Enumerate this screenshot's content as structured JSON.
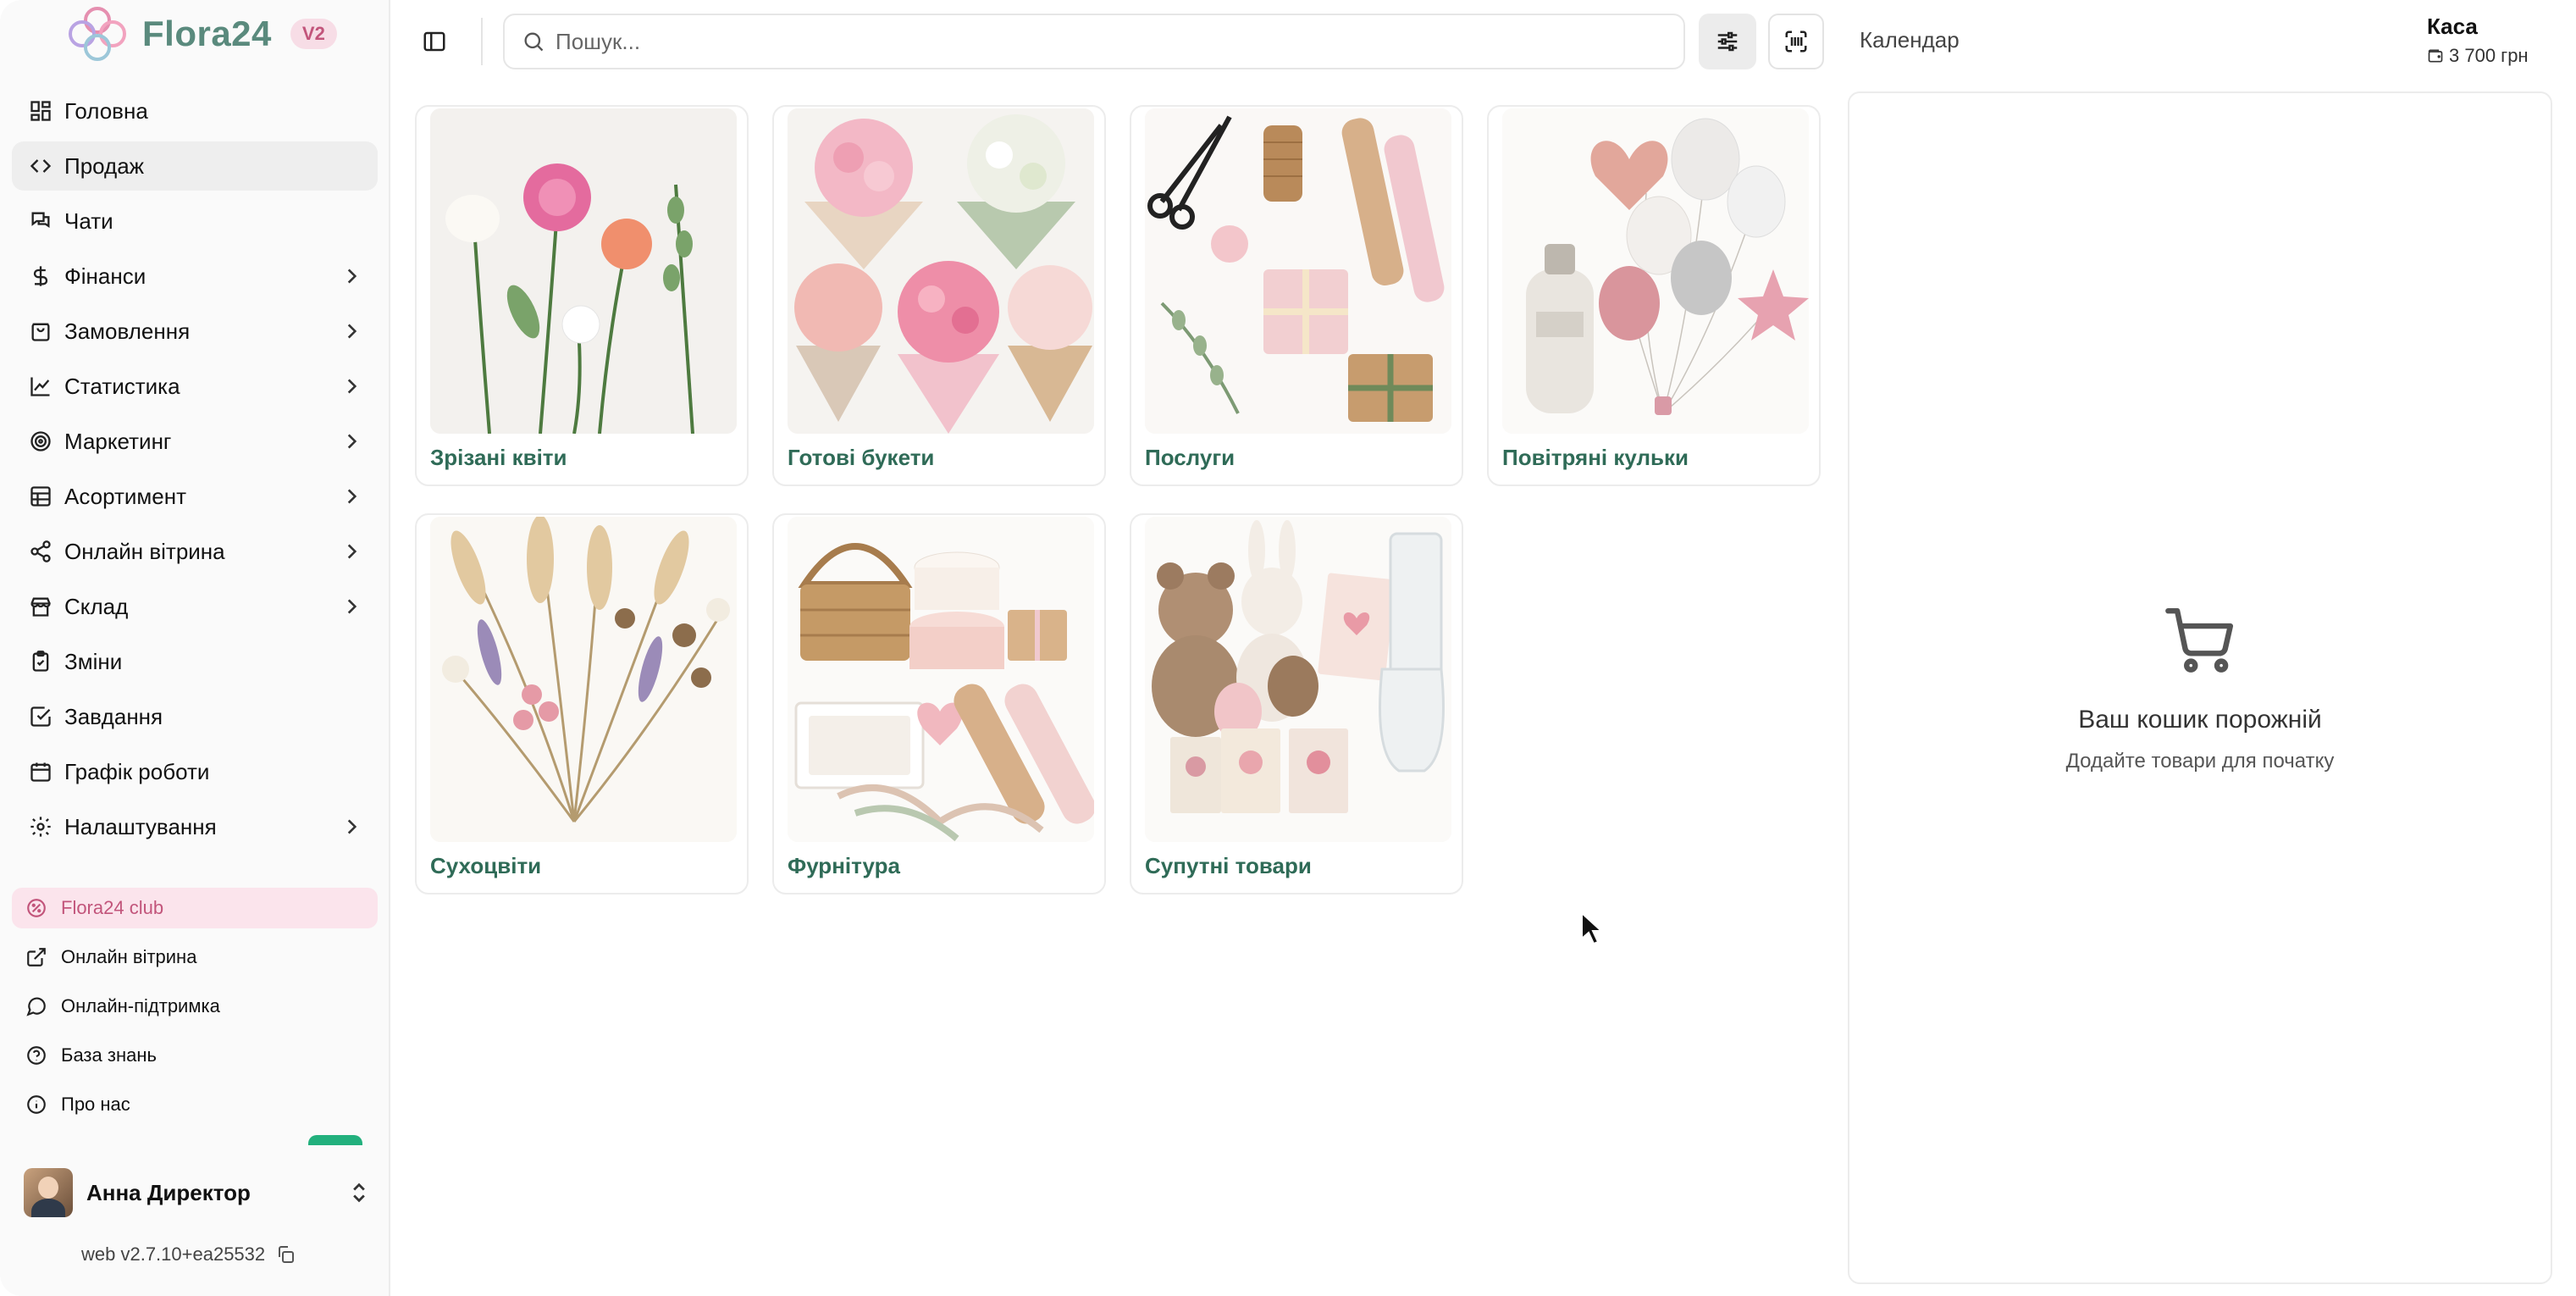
{
  "brand": {
    "name": "Flora24",
    "badge": "V2"
  },
  "nav": [
    {
      "label": "Головна",
      "icon": "grid-icon",
      "chevron": false,
      "active": false
    },
    {
      "label": "Продаж",
      "icon": "code-icon",
      "chevron": false,
      "active": true
    },
    {
      "label": "Чати",
      "icon": "chat-icon",
      "chevron": false,
      "active": false
    },
    {
      "label": "Фінанси",
      "icon": "dollar-icon",
      "chevron": true,
      "active": false
    },
    {
      "label": "Замовлення",
      "icon": "bag-icon",
      "chevron": true,
      "active": false
    },
    {
      "label": "Статистика",
      "icon": "line-chart-icon",
      "chevron": true,
      "active": false
    },
    {
      "label": "Маркетинг",
      "icon": "target-icon",
      "chevron": true,
      "active": false
    },
    {
      "label": "Асортимент",
      "icon": "table-icon",
      "chevron": true,
      "active": false
    },
    {
      "label": "Онлайн вітрина",
      "icon": "share-icon",
      "chevron": true,
      "active": false
    },
    {
      "label": "Склад",
      "icon": "store-icon",
      "chevron": true,
      "active": false
    },
    {
      "label": "Зміни",
      "icon": "clipboard-icon",
      "chevron": false,
      "active": false
    },
    {
      "label": "Завдання",
      "icon": "check-square-icon",
      "chevron": false,
      "active": false
    },
    {
      "label": "Графік роботи",
      "icon": "calendar-icon",
      "chevron": false,
      "active": false
    },
    {
      "label": "Налаштування",
      "icon": "gear-icon",
      "chevron": true,
      "active": false
    }
  ],
  "links": [
    {
      "label": "Flora24 club",
      "icon": "badge-icon"
    },
    {
      "label": "Онлайн вітрина",
      "icon": "external-link-icon"
    },
    {
      "label": "Онлайн-підтримка",
      "icon": "message-circle-icon"
    },
    {
      "label": "База знань",
      "icon": "help-circle-icon"
    },
    {
      "label": "Про нас",
      "icon": "info-icon"
    }
  ],
  "user": {
    "name": "Анна Директор"
  },
  "version": "web v2.7.10+ea25532",
  "search": {
    "placeholder": "Пошук..."
  },
  "calendar_label": "Календар",
  "cash": {
    "title": "Каса",
    "amount": "3 700 грн"
  },
  "categories": [
    {
      "label": "Зрізані квіти",
      "image": "cut-flowers"
    },
    {
      "label": "Готові букети",
      "image": "bouquets"
    },
    {
      "label": "Послуги",
      "image": "services"
    },
    {
      "label": "Повітряні кульки",
      "image": "balloons"
    },
    {
      "label": "Сухоцвіти",
      "image": "dried-flowers"
    },
    {
      "label": "Фурнітура",
      "image": "supplies"
    },
    {
      "label": "Супутні товари",
      "image": "gifts"
    }
  ],
  "cart": {
    "title": "Ваш кошик порожній",
    "subtitle": "Додайте товари для початку"
  },
  "colors": {
    "accent": "#2f6b57",
    "brand": "#5a8a7d",
    "club": "#c2557b"
  }
}
